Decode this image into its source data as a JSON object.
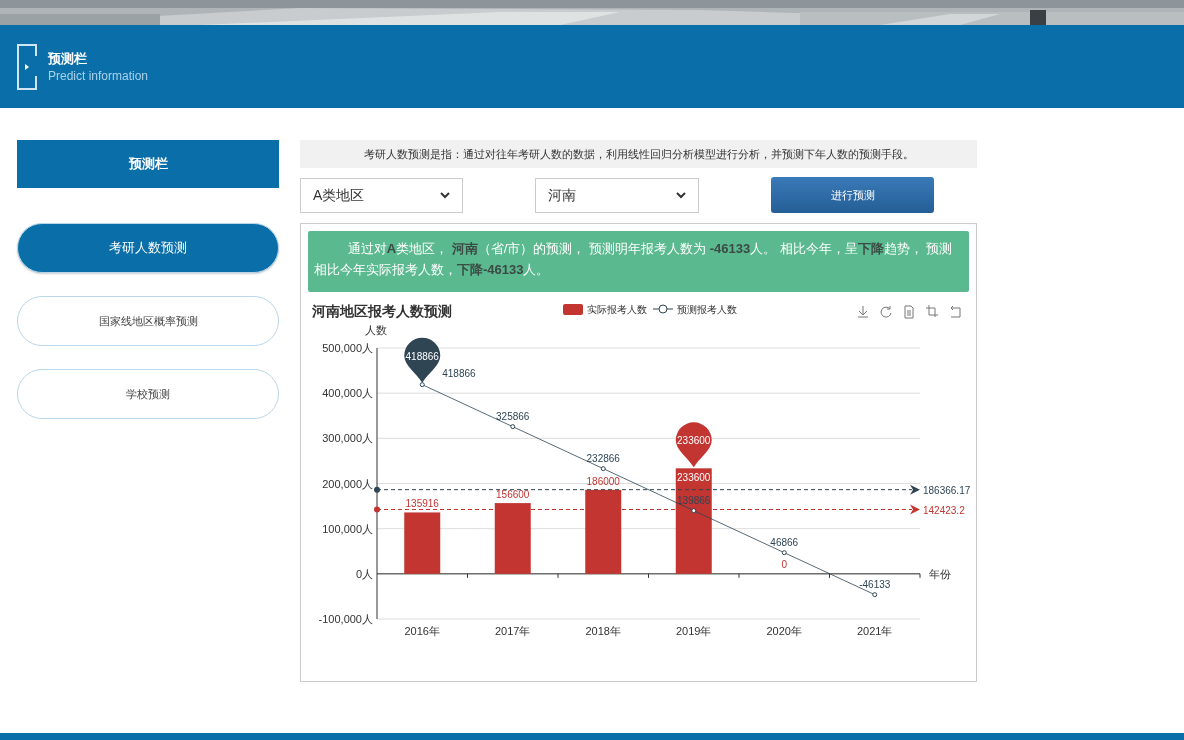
{
  "header": {
    "title": "预测栏",
    "subtitle": "Predict information"
  },
  "sidebar": {
    "title": "预测栏",
    "items": [
      {
        "label": "考研人数预测",
        "selected": true
      },
      {
        "label": "国家线地区概率预测",
        "selected": false
      },
      {
        "label": "学校预测",
        "selected": false
      }
    ]
  },
  "intro": "考研人数预测是指：通过对往年考研人数的数据，利用线性回归分析模型进行分析，并预测下年人数的预测手段。",
  "region_select": {
    "value": "A类地区"
  },
  "province_select": {
    "value": "河南"
  },
  "predict_button": "进行预测",
  "result": "通过对**A**类地区， **河南**（省/市）的预测， 预测明年报考人数为 **-46133**人。 相比今年，呈**下降**趋势， 预测相比今年实际报考人数，**下降-46133**人。",
  "chart_data": {
    "type": "bar",
    "title": "河南地区报考人数预测",
    "xlabel": "年份",
    "ylabel": "人数",
    "categories": [
      "2016年",
      "2017年",
      "2018年",
      "2019年",
      "2020年",
      "2021年"
    ],
    "series": [
      {
        "name": "实际报考人数",
        "color": "#c23531",
        "type": "bar",
        "values": [
          135916,
          156600,
          186000,
          233600,
          0,
          null
        ]
      },
      {
        "name": "预测报考人数",
        "color": "#2f4554",
        "type": "line",
        "marker": "circle",
        "values": [
          418866,
          325866,
          232866,
          139866,
          46866,
          -46133
        ]
      }
    ],
    "ylim": [
      -100000,
      500000
    ],
    "yticks": [
      {
        "value": -100000,
        "label": "-100,000人"
      },
      {
        "value": 0,
        "label": "0人"
      },
      {
        "value": 100000,
        "label": "100,000人"
      },
      {
        "value": 200000,
        "label": "200,000人"
      },
      {
        "value": 300000,
        "label": "300,000人"
      },
      {
        "value": 400000,
        "label": "400,000人"
      },
      {
        "value": 500000,
        "label": "500,000人"
      }
    ],
    "data_labels": true,
    "grid": true,
    "legend": true,
    "annotations": [
      {
        "text": "418866",
        "x": "2016年",
        "y": 418866
      },
      {
        "text": "233600",
        "x": "2019年",
        "y": 233600
      }
    ],
    "ref_lines": [
      {
        "axis": "y",
        "value": 186366.17,
        "label": "186366.17",
        "color": "#2f4554"
      },
      {
        "axis": "y",
        "value": 142423.2,
        "label": "142423.2",
        "color": "#c23531"
      }
    ]
  }
}
